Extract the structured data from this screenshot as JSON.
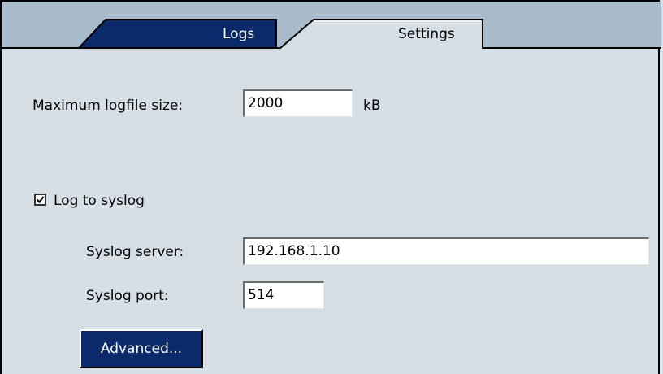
{
  "tabs": [
    {
      "label": "Logs",
      "active": false
    },
    {
      "label": "Settings",
      "active": true
    }
  ],
  "settings": {
    "max_logfile_label": "Maximum logfile size:",
    "max_logfile_value": "2000",
    "max_logfile_unit": "kB",
    "log_to_syslog_label": "Log to syslog",
    "log_to_syslog_checked": true,
    "syslog_server_label": "Syslog server:",
    "syslog_server_value": "192.168.1.10",
    "syslog_port_label": "Syslog port:",
    "syslog_port_value": "514",
    "advanced_button_label": "Advanced..."
  },
  "colors": {
    "background": "#d6dfe6",
    "inactive_tab": "#0a2a6a",
    "button": "#0a2a6a"
  }
}
